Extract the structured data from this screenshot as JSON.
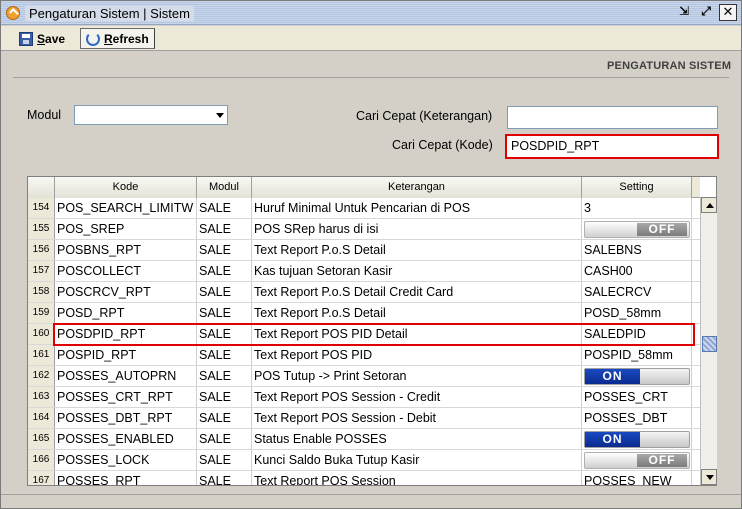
{
  "window": {
    "title": "Pengaturan Sistem | Sistem",
    "buttons": {
      "restore": "⇲",
      "maximize": "⤢",
      "close": "✕"
    }
  },
  "toolbar": {
    "save_label_u": "S",
    "save_label_rest": "ave",
    "refresh_label_u": "R",
    "refresh_label_rest": "efresh"
  },
  "section_header": "PENGATURAN SISTEM",
  "filters": {
    "modul_label": "Modul",
    "modul_value": "",
    "ket_label": "Cari Cepat (Keterangan)",
    "ket_value": "",
    "kode_label": "Cari Cepat (Kode)",
    "kode_value": "POSDPID_RPT"
  },
  "table": {
    "columns": [
      "",
      "Kode",
      "Modul",
      "Keterangan",
      "Setting"
    ],
    "rows": [
      {
        "no": "154",
        "kode": "POS_SEARCH_LIMITW",
        "modul": "SALE",
        "ket": "Huruf Minimal Untuk Pencarian di POS",
        "setting": "3",
        "type": "text"
      },
      {
        "no": "155",
        "kode": "POS_SREP",
        "modul": "SALE",
        "ket": "POS SRep harus di isi",
        "setting": "OFF",
        "type": "off"
      },
      {
        "no": "156",
        "kode": "POSBNS_RPT",
        "modul": "SALE",
        "ket": "Text Report P.o.S Detail",
        "setting": "SALEBNS",
        "type": "text"
      },
      {
        "no": "157",
        "kode": "POSCOLLECT",
        "modul": "SALE",
        "ket": "Kas tujuan Setoran Kasir",
        "setting": "CASH00",
        "type": "text"
      },
      {
        "no": "158",
        "kode": "POSCRCV_RPT",
        "modul": "SALE",
        "ket": "Text Report P.o.S Detail Credit Card",
        "setting": "SALECRCV",
        "type": "text"
      },
      {
        "no": "159",
        "kode": "POSD_RPT",
        "modul": "SALE",
        "ket": "Text Report P.o.S Detail",
        "setting": "POSD_58mm",
        "type": "text"
      },
      {
        "no": "160",
        "kode": "POSDPID_RPT",
        "modul": "SALE",
        "ket": "Text Report POS PID Detail",
        "setting": "SALEDPID",
        "type": "text"
      },
      {
        "no": "161",
        "kode": "POSPID_RPT",
        "modul": "SALE",
        "ket": "Text Report POS PID",
        "setting": "POSPID_58mm",
        "type": "text"
      },
      {
        "no": "162",
        "kode": "POSSES_AUTOPRN",
        "modul": "SALE",
        "ket": "POS Tutup -> Print Setoran",
        "setting": "ON",
        "type": "on"
      },
      {
        "no": "163",
        "kode": "POSSES_CRT_RPT",
        "modul": "SALE",
        "ket": "Text Report POS Session - Credit",
        "setting": "POSSES_CRT",
        "type": "text"
      },
      {
        "no": "164",
        "kode": "POSSES_DBT_RPT",
        "modul": "SALE",
        "ket": "Text Report POS Session - Debit",
        "setting": "POSSES_DBT",
        "type": "text"
      },
      {
        "no": "165",
        "kode": "POSSES_ENABLED",
        "modul": "SALE",
        "ket": "Status Enable POSSES",
        "setting": "ON",
        "type": "on"
      },
      {
        "no": "166",
        "kode": "POSSES_LOCK",
        "modul": "SALE",
        "ket": "Kunci Saldo Buka Tutup Kasir",
        "setting": "OFF",
        "type": "off"
      },
      {
        "no": "167",
        "kode": "POSSES_RPT",
        "modul": "SALE",
        "ket": "Text Report POS Session",
        "setting": "POSSES_NEW",
        "type": "text"
      }
    ]
  }
}
